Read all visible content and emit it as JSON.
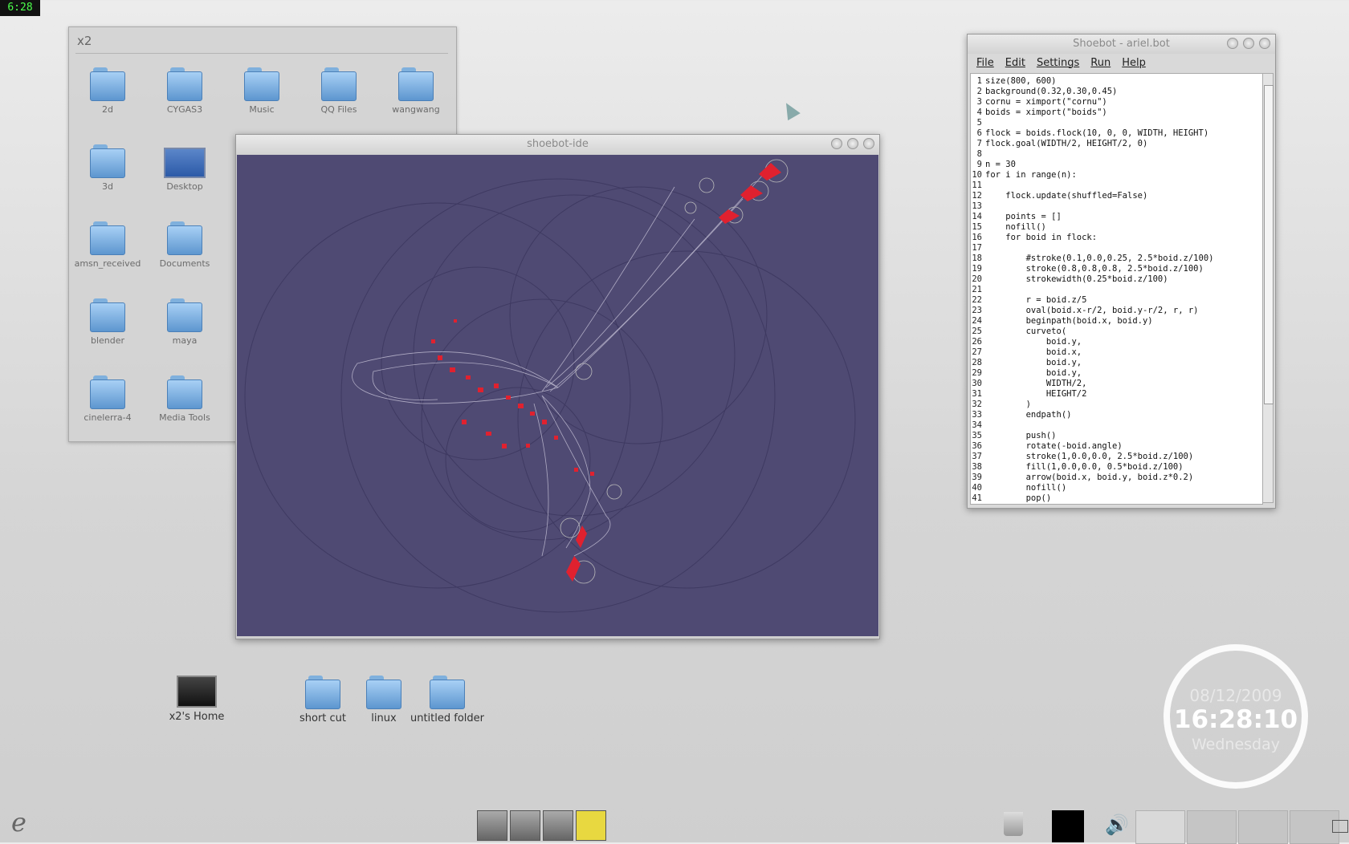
{
  "top_clock": "6:28",
  "folder_window": {
    "title": "x2",
    "items": [
      {
        "label": "2d",
        "type": "folder"
      },
      {
        "label": "CYGAS3",
        "type": "folder"
      },
      {
        "label": "Music",
        "type": "folder"
      },
      {
        "label": "QQ Files",
        "type": "folder"
      },
      {
        "label": "wangwang",
        "type": "folder"
      },
      {
        "label": "3d",
        "type": "folder"
      },
      {
        "label": "Desktop",
        "type": "desktop"
      },
      {
        "label": "amsn_received",
        "type": "folder"
      },
      {
        "label": "Documents",
        "type": "folder"
      },
      {
        "label": "blender",
        "type": "folder"
      },
      {
        "label": "maya",
        "type": "folder"
      },
      {
        "label": "cinelerra-4",
        "type": "folder"
      },
      {
        "label": "Media Tools",
        "type": "folder"
      }
    ]
  },
  "ide_window": {
    "title": "shoebot-ide"
  },
  "editor": {
    "title": "Shoebot - ariel.bot",
    "menu": [
      "File",
      "Edit",
      "Settings",
      "Run",
      "Help"
    ],
    "line_numbers": [
      "1",
      "2",
      "3",
      "4",
      "5",
      "6",
      "7",
      "8",
      "9",
      "10",
      "11",
      "12",
      "13",
      "14",
      "15",
      "16",
      "17",
      "18",
      "19",
      "20",
      "21",
      "22",
      "23",
      "24",
      "25",
      "26",
      "27",
      "28",
      "29",
      "30",
      "31",
      "32",
      "33",
      "34",
      "35",
      "36",
      "37",
      "38",
      "39",
      "40",
      "41"
    ],
    "code": "size(800, 600)\nbackground(0.32,0.30,0.45)\ncornu = ximport(\"cornu\")\nboids = ximport(\"boids\")\n\nflock = boids.flock(10, 0, 0, WIDTH, HEIGHT)\nflock.goal(WIDTH/2, HEIGHT/2, 0)\n\nn = 30\nfor i in range(n):\n\n    flock.update(shuffled=False)\n\n    points = []\n    nofill()\n    for boid in flock:\n\n        #stroke(0.1,0.0,0.25, 2.5*boid.z/100)\n        stroke(0.8,0.8,0.8, 2.5*boid.z/100)\n        strokewidth(0.25*boid.z/100)\n\n        r = boid.z/5\n        oval(boid.x-r/2, boid.y-r/2, r, r)\n        beginpath(boid.x, boid.y)\n        curveto(\n            boid.y,\n            boid.x,\n            boid.y,\n            boid.y,\n            WIDTH/2,\n            HEIGHT/2\n        )\n        endpath()\n\n        push()\n        rotate(-boid.angle)\n        stroke(1,0.0,0.0, 2.5*boid.z/100)\n        fill(1,0.0,0.0, 0.5*boid.z/100)\n        arrow(boid.x, boid.y, boid.z*0.2)\n        nofill()\n        pop()"
  },
  "desktop_icons": [
    {
      "label": "x2's Home",
      "type": "computer"
    },
    {
      "label": "short cut",
      "type": "folder"
    },
    {
      "label": "linux",
      "type": "folder"
    },
    {
      "label": "untitled folder",
      "type": "folder"
    }
  ],
  "clock_widget": {
    "date": "08/12/2009",
    "time": "16:28:10",
    "weekday": "Wednesday"
  }
}
